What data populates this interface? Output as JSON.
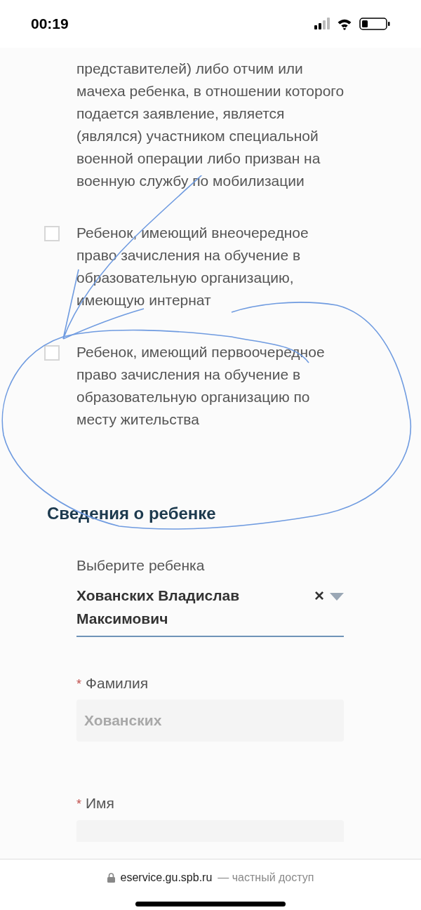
{
  "status_bar": {
    "time": "00:19"
  },
  "cut_option_text": "представителей) либо отчим или мачеха ребенка, в отношении которого подается заявление, является (являлся) участником специальной военной операции либо призван на военную службу по мобилизации",
  "options": [
    {
      "label": "Ребенок, имеющий внеочередное право зачисления на обучение в образовательную организацию, имеющую интернат",
      "checked": false
    },
    {
      "label": "Ребенок, имеющий первоочередное право зачисления на обучение в образовательную организацию по месту жительства",
      "checked": false
    }
  ],
  "section_title": "Сведения о ребенке",
  "child_select": {
    "label": "Выберите ребенка",
    "value": "Хованских Владислав Максимович",
    "clear": "×"
  },
  "fields": [
    {
      "label": "Фамилия",
      "required": true,
      "required_mark": "*",
      "value": "Хованских",
      "disabled": true
    },
    {
      "label": "Имя",
      "required": true,
      "required_mark": "*",
      "disabled": true
    }
  ],
  "browser_bar": {
    "domain": "eservice.gu.spb.ru",
    "suffix": "— частный доступ"
  }
}
